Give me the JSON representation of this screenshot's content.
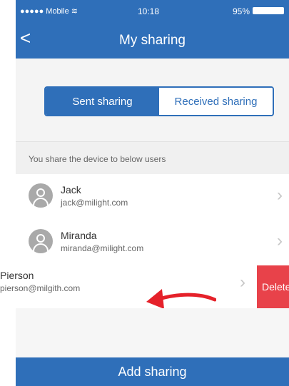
{
  "status_bar": {
    "carrier": "●●●●● Mobile ≋",
    "time": "10:18",
    "battery": "95%"
  },
  "nav": {
    "back_icon": "<",
    "title": "My sharing"
  },
  "tabs": {
    "sent": "Sent sharing",
    "received": "Received sharing",
    "selected": "sent"
  },
  "section": {
    "label": "You share the device to below users"
  },
  "users": [
    {
      "name": "Jack",
      "email": "jack@milight.com"
    },
    {
      "name": "Miranda",
      "email": "miranda@milight.com"
    },
    {
      "name": "Pierson",
      "email": "pierson@milgith.com"
    }
  ],
  "swipe_action": {
    "delete_label": "Delete"
  },
  "footer": {
    "add_label": "Add sharing"
  },
  "colors": {
    "primary": "#2f6fb9",
    "delete": "#e8424a",
    "arrow": "#e5212a"
  }
}
